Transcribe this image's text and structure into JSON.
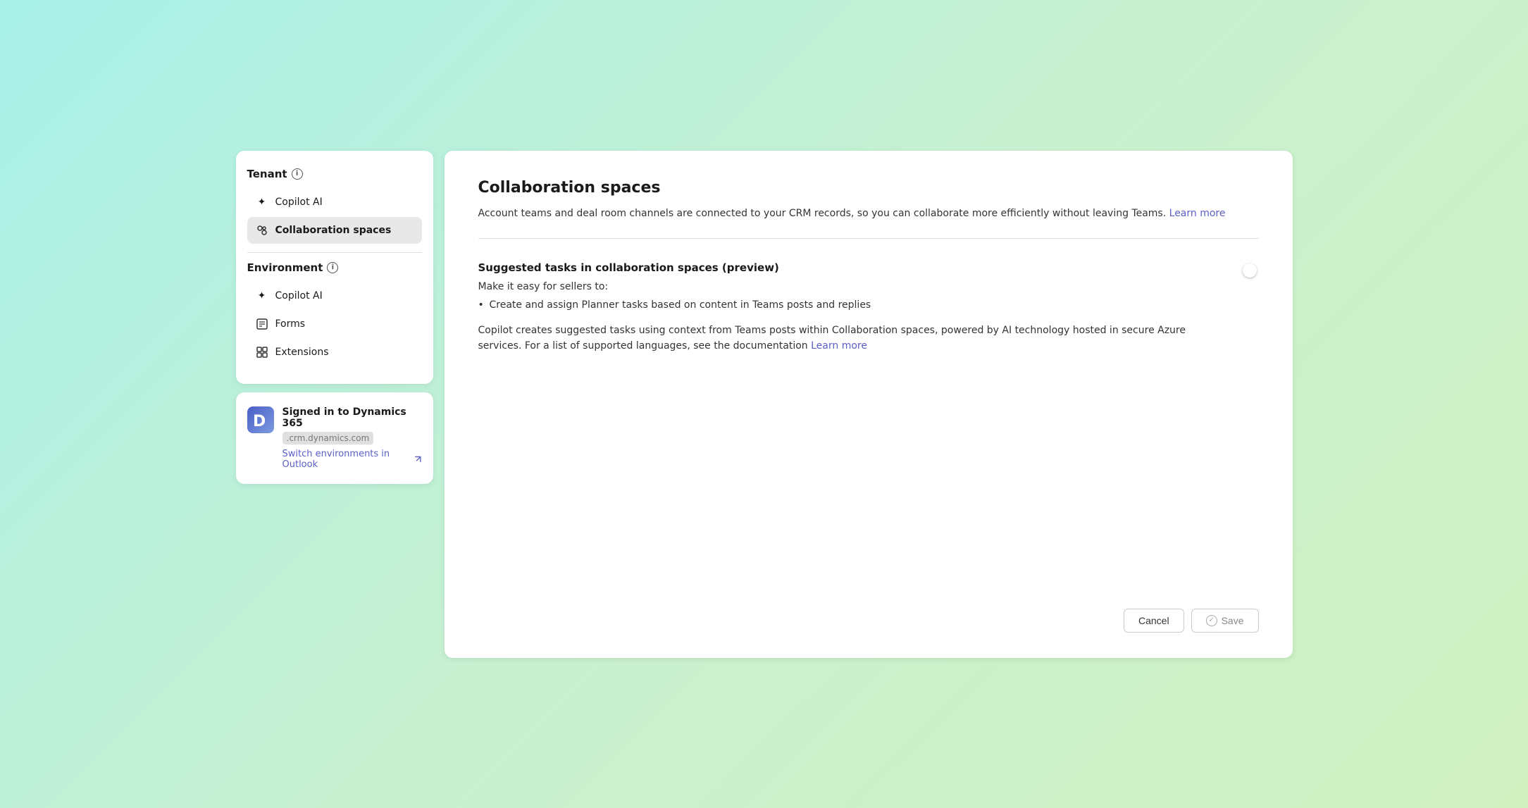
{
  "sidebar": {
    "tenant_section": {
      "label": "Tenant",
      "show_info": true
    },
    "tenant_items": [
      {
        "id": "copilot-ai-tenant",
        "label": "Copilot AI",
        "icon": "sparkle",
        "active": false
      },
      {
        "id": "collaboration-spaces",
        "label": "Collaboration spaces",
        "icon": "collab",
        "active": true
      }
    ],
    "environment_section": {
      "label": "Environment",
      "show_info": true
    },
    "environment_items": [
      {
        "id": "copilot-ai-env",
        "label": "Copilot AI",
        "icon": "sparkle",
        "active": false
      },
      {
        "id": "forms",
        "label": "Forms",
        "icon": "forms",
        "active": false
      },
      {
        "id": "extensions",
        "label": "Extensions",
        "icon": "extensions",
        "active": false
      }
    ]
  },
  "signed_in": {
    "title": "Signed in to Dynamics 365",
    "email_masked": ".crm.dynamics.com",
    "switch_label": "Switch environments in Outlook",
    "external_link": true
  },
  "main": {
    "page_title": "Collaboration spaces",
    "description": "Account teams and deal room channels are connected to your CRM records, so you can collaborate more efficiently without leaving Teams.",
    "learn_more_label": "Learn more",
    "feature": {
      "title": "Suggested tasks in collaboration spaces (preview)",
      "subtitle": "Make it easy for sellers to:",
      "list_items": [
        "Create and assign Planner tasks based on content in Teams posts and replies"
      ],
      "description": "Copilot creates suggested tasks using context from Teams posts within Collaboration spaces, powered by AI technology hosted in secure Azure services. For a list of supported languages, see the documentation",
      "learn_more_label": "Learn more",
      "toggle_enabled": true
    }
  },
  "footer": {
    "cancel_label": "Cancel",
    "save_label": "Save"
  }
}
